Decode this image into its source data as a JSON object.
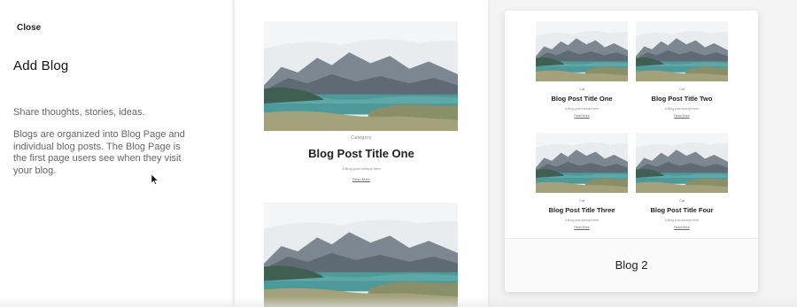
{
  "panel": {
    "close_label": "Close",
    "title": "Add Blog",
    "tagline": "Share thoughts, stories, ideas.",
    "description": "Blogs are organized into Blog Page and individual blog posts. The Blog Page is the first page users see when they visit your blog."
  },
  "templates": [
    {
      "category": "Category",
      "post_title": "Blog Post Title One",
      "meta": "A Blog post excerpt here",
      "read_more": "Read More"
    },
    {
      "label": "Blog 2",
      "posts": [
        {
          "category": "Cat",
          "title": "Blog Post Title One",
          "meta": "A Blog post excerpt here",
          "read_more": "Read More"
        },
        {
          "category": "Cat",
          "title": "Blog Post Title Two",
          "meta": "A Blog post excerpt here",
          "read_more": "Read More"
        },
        {
          "category": "Cat",
          "title": "Blog Post Title Three",
          "meta": "A Blog post excerpt here",
          "read_more": "Read More"
        },
        {
          "category": "Cat",
          "title": "Blog Post Title Four",
          "meta": "A Blog post excerpt here",
          "read_more": "Read More"
        }
      ]
    }
  ],
  "icons": {
    "cursor": "mouse-pointer-icon",
    "landscape": "landscape-image-icon"
  },
  "colors": {
    "water": "#4e9a9b",
    "mountain": "#6f7b86",
    "sky": "#e9ecef",
    "grass": "#8a8f6a"
  }
}
